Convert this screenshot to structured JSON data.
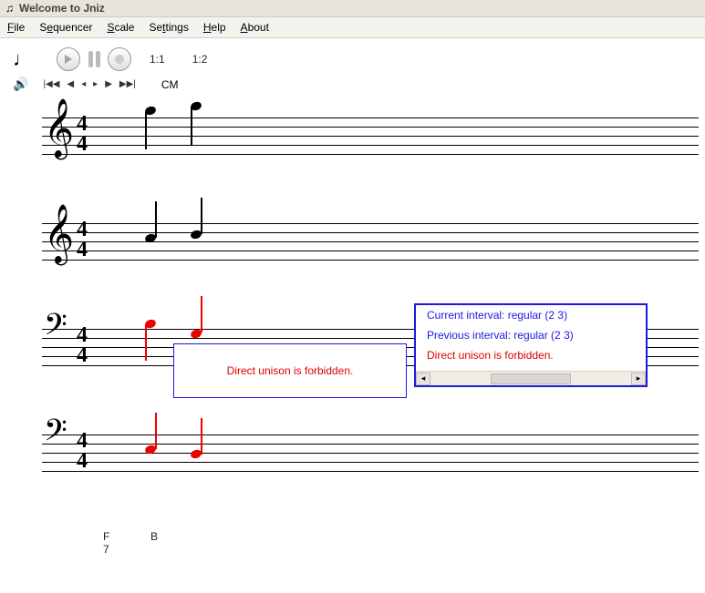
{
  "window": {
    "title": "Welcome to Jniz"
  },
  "menu": {
    "file": "File",
    "sequencer": "Sequencer",
    "scale": "Scale",
    "settings": "Settings",
    "help": "Help",
    "about": "About"
  },
  "toolbar": {
    "pos1": "1:1",
    "pos2": "1:2",
    "key": "CM"
  },
  "tooltip": {
    "message": "Direct unison is forbidden."
  },
  "panel": {
    "line1": "Current interval: regular (2 3)",
    "line2": "Previous interval: regular (2 3)",
    "line3": "Direct unison is forbidden."
  },
  "chords": {
    "c1top": "F",
    "c1bot": "7",
    "c2top": "B"
  }
}
